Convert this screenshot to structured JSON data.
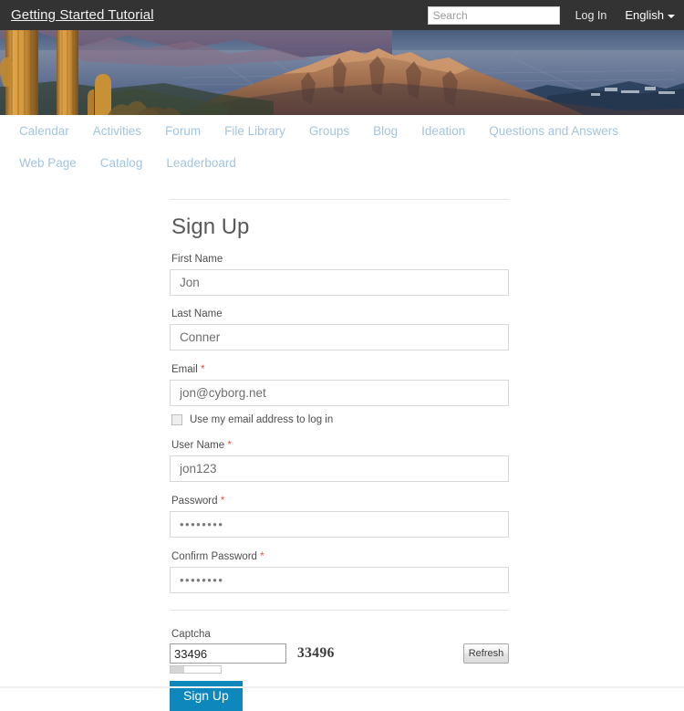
{
  "header": {
    "site_title": "Getting Started Tutorial",
    "search": {
      "placeholder": "Search",
      "value": ""
    },
    "login_label": "Log In",
    "language_label": "English",
    "background_color": "#333333"
  },
  "banner": {
    "alt": "Desert mountain landscape at sunset with saguaro cactus",
    "sky_color": "#6a7f9c",
    "mountain_color": "#9a6a52",
    "cactus_color": "#d79a3e",
    "valley_color": "#3c5170"
  },
  "nav": {
    "items": [
      {
        "label": "Calendar"
      },
      {
        "label": "Activities"
      },
      {
        "label": "Forum"
      },
      {
        "label": "File Library"
      },
      {
        "label": "Groups"
      },
      {
        "label": "Blog"
      },
      {
        "label": "Ideation"
      },
      {
        "label": "Questions and Answers"
      },
      {
        "label": "Web Page"
      },
      {
        "label": "Catalog"
      },
      {
        "label": "Leaderboard"
      }
    ],
    "link_color": "#a3c4e0"
  },
  "form": {
    "heading": "Sign Up",
    "required_marker": "*",
    "fields": {
      "first_name": {
        "label": "First Name",
        "value": "Jon",
        "required": false
      },
      "last_name": {
        "label": "Last Name",
        "value": "Conner",
        "required": false
      },
      "email": {
        "label": "Email",
        "value": "jon@cyborg.net",
        "required": true
      },
      "user_name": {
        "label": "User Name",
        "value": "jon123",
        "required": true
      },
      "password": {
        "label": "Password",
        "value": "••••••••",
        "required": true
      },
      "confirm_password": {
        "label": "Confirm Password",
        "value": "••••••••",
        "required": true
      }
    },
    "email_login_checkbox": {
      "label": "Use my email address to log in",
      "checked": false
    },
    "captcha": {
      "label": "Captcha",
      "input_value": "33496",
      "challenge_text": "33496",
      "refresh_label": "Refresh"
    },
    "submit_label": "Sign Up",
    "accent_color": "#0e87bd",
    "required_color": "#e8583b"
  }
}
